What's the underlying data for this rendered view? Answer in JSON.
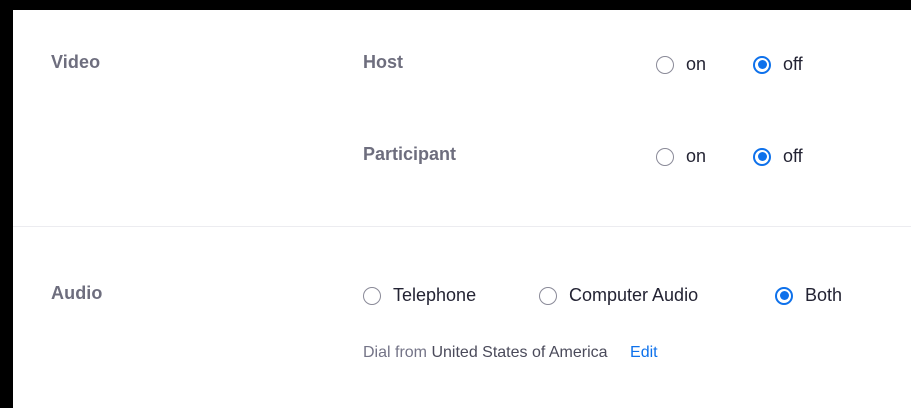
{
  "video": {
    "section_label": "Video",
    "host": {
      "label": "Host",
      "options": [
        "on",
        "off"
      ],
      "selected": "off"
    },
    "participant": {
      "label": "Participant",
      "options": [
        "on",
        "off"
      ],
      "selected": "off"
    }
  },
  "audio": {
    "section_label": "Audio",
    "options": [
      "Telephone",
      "Computer Audio",
      "Both"
    ],
    "selected": "Both",
    "dial_prefix": "Dial from",
    "dial_country": "United States of America",
    "edit_label": "Edit"
  },
  "colors": {
    "accent": "#0e71eb",
    "label_gray": "#6e6e7e",
    "text_dark": "#232333"
  },
  "icons": {
    "radio_unchecked": "radio-unchecked-icon",
    "radio_checked": "radio-checked-icon"
  }
}
